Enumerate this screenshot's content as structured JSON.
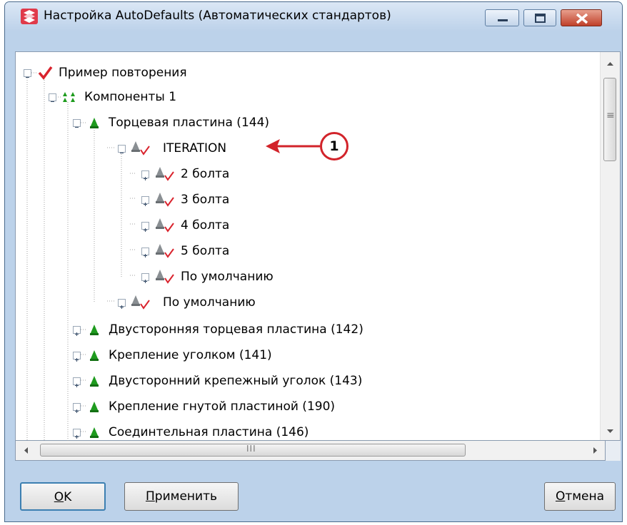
{
  "window": {
    "title": "Настройка AutoDefaults (Автоматических стандартов)"
  },
  "tree": {
    "root": {
      "label": "Пример повторения",
      "expanded": true
    },
    "components_group": {
      "label": "Компоненты 1",
      "expanded": true
    },
    "items": [
      {
        "label": "Торцевая пластина (144)",
        "expanded": true
      },
      {
        "label": "ITERATION",
        "expanded": true
      },
      {
        "label": "2 болта",
        "expanded": false
      },
      {
        "label": "3 болта",
        "expanded": false
      },
      {
        "label": "4 болта",
        "expanded": false
      },
      {
        "label": "5 болта",
        "expanded": false
      },
      {
        "label": "По умолчанию",
        "expanded": false
      },
      {
        "label": "По умолчанию",
        "expanded": false
      },
      {
        "label": "Двусторонняя торцевая пластина (142)",
        "expanded": false
      },
      {
        "label": "Крепление уголком (141)",
        "expanded": false
      },
      {
        "label": "Двусторонний крепежный уголок (143)",
        "expanded": false
      },
      {
        "label": "Крепление гнутой пластиной (190)",
        "expanded": false
      },
      {
        "label": "Соединтельная пластина (146)",
        "expanded": false
      }
    ]
  },
  "callout": {
    "number": "1",
    "color": "#d2232a"
  },
  "scrollbar": {
    "h_grip": "III",
    "v_grip": "≡"
  },
  "buttons": {
    "ok": {
      "accel": "O",
      "rest": "K"
    },
    "apply": {
      "accel": "П",
      "rest": "рименить"
    },
    "cancel": {
      "accel": "О",
      "rest": "тмена"
    }
  },
  "colors": {
    "check_red": "#d9232d",
    "component_green": "#1e9b1e",
    "component_gray": "#8a8f93",
    "frame_blue": "#bcd2ea"
  }
}
